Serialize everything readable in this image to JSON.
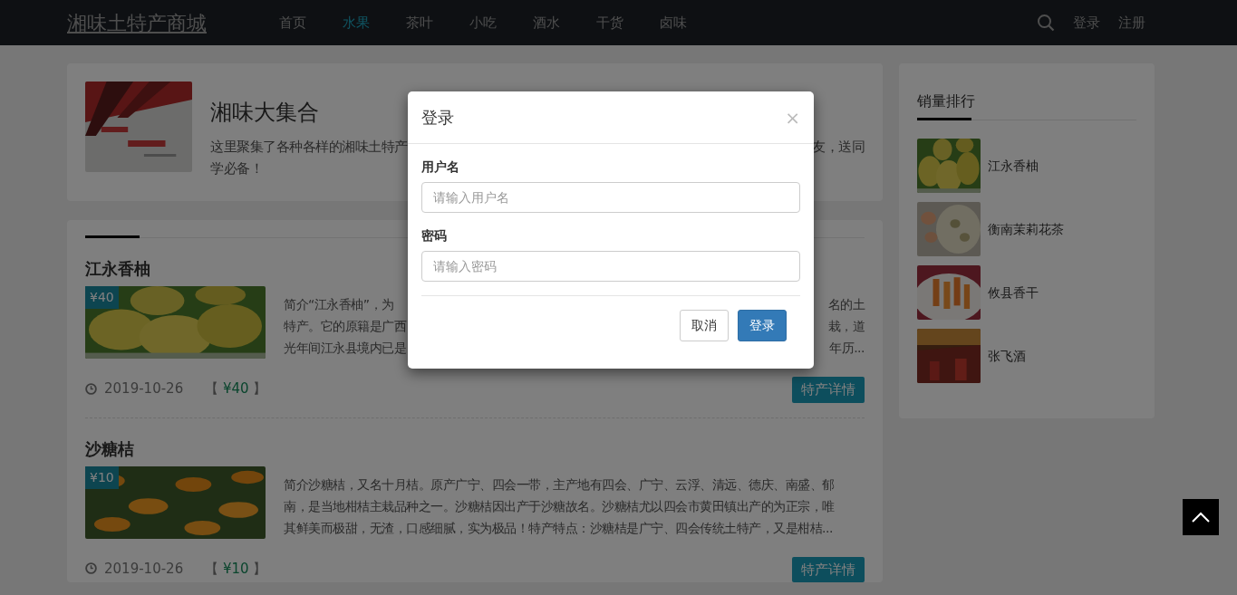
{
  "navbar": {
    "brand": "湘味土特产商城",
    "links": [
      {
        "label": "首页",
        "selected": false
      },
      {
        "label": "水果",
        "selected": true
      },
      {
        "label": "茶叶",
        "selected": false
      },
      {
        "label": "小吃",
        "selected": false
      },
      {
        "label": "酒水",
        "selected": false
      },
      {
        "label": "干货",
        "selected": false
      },
      {
        "label": "卤味",
        "selected": false
      }
    ],
    "actions": [
      "登录",
      "注册"
    ]
  },
  "intro": {
    "title": "湘味大集合",
    "lines": [
      [
        "这里聚集了各种各样的湘味土特产",
        "友，送同"
      ],
      [
        "学必备！"
      ]
    ]
  },
  "products": [
    {
      "title": "江永香柚",
      "badge": "¥40",
      "lines": [
        [
          "简介“江永香柚”，为",
          "名的土"
        ],
        [
          "特产。它的原籍是广西",
          "栽，道"
        ],
        [
          "光年间江永县境内已是",
          "年历..."
        ]
      ],
      "date": "2019-10-26",
      "bracket_open": "【",
      "price": "¥40",
      "bracket_close": "】",
      "button": "特产详情"
    },
    {
      "title": "沙糖桔",
      "badge": "¥10",
      "lines": [
        [
          "简介沙糖桔，又名十月桔。原产广宁、四会一带，主产地有四会、广宁、云浮、清远、德庆、南盛、郁"
        ],
        [
          "南，是当地柑桔主栽品种之一。沙糖桔因出产于沙糖故名。沙糖桔尤以四会市黄田镇出产的为正宗，唯"
        ],
        [
          "其鲜美而极甜，无渣，口感细腻，实为极品！特产特点：沙糖桔是广宁、四会传统土特产，又是柑桔..."
        ]
      ],
      "date": "2019-10-26",
      "bracket_open": "【",
      "price": "¥10",
      "bracket_close": "】",
      "button": "特产详情"
    }
  ],
  "sidebar": {
    "title": "销量排行",
    "items": [
      {
        "name": "江永香柚"
      },
      {
        "name": "衡南茉莉花茶"
      },
      {
        "name": "攸县香干"
      },
      {
        "name": "张飞酒"
      }
    ]
  },
  "modal": {
    "title": "登录",
    "close": "×",
    "fields": [
      {
        "label": "用户名",
        "placeholder": "请输入用户名"
      },
      {
        "label": "密码",
        "placeholder": "请输入密码"
      }
    ],
    "buttons": [
      {
        "label": "取消",
        "kind": "secondary"
      },
      {
        "label": "登录",
        "kind": "primary"
      }
    ]
  }
}
